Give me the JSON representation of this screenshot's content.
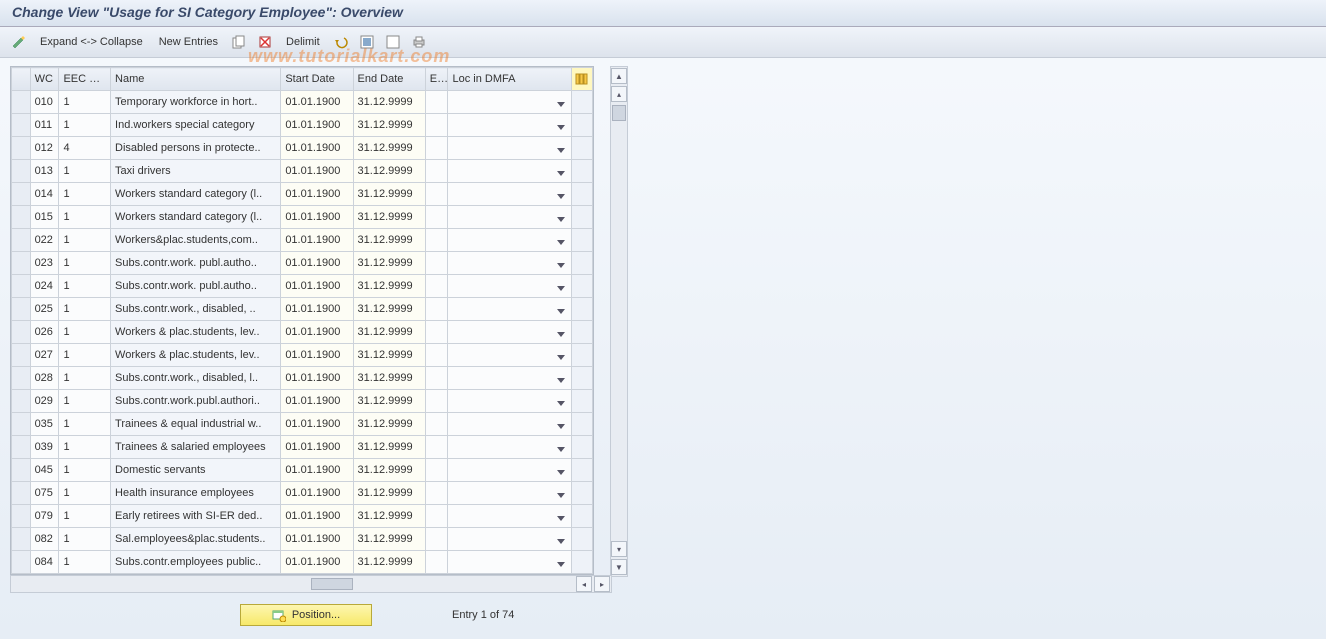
{
  "title": "Change View \"Usage for SI Category Employee\": Overview",
  "watermark": "www.tutorialkart.com",
  "toolbar": {
    "expand_collapse": "Expand <-> Collapse",
    "new_entries": "New Entries",
    "delimit": "Delimit"
  },
  "columns": {
    "wc": "WC",
    "eec": "EEC use",
    "name": "Name",
    "start": "Start Date",
    "end": "End Date",
    "e": "E...",
    "loc": "Loc in DMFA"
  },
  "rows": [
    {
      "wc": "010",
      "eec": "1",
      "name": "Temporary workforce in hort..",
      "start": "01.01.1900",
      "end": "31.12.9999",
      "e": "",
      "loc": ""
    },
    {
      "wc": "011",
      "eec": "1",
      "name": "Ind.workers special category",
      "start": "01.01.1900",
      "end": "31.12.9999",
      "e": "",
      "loc": ""
    },
    {
      "wc": "012",
      "eec": "4",
      "name": "Disabled persons in protecte..",
      "start": "01.01.1900",
      "end": "31.12.9999",
      "e": "",
      "loc": ""
    },
    {
      "wc": "013",
      "eec": "1",
      "name": "Taxi drivers",
      "start": "01.01.1900",
      "end": "31.12.9999",
      "e": "",
      "loc": ""
    },
    {
      "wc": "014",
      "eec": "1",
      "name": "Workers standard category (l..",
      "start": "01.01.1900",
      "end": "31.12.9999",
      "e": "",
      "loc": ""
    },
    {
      "wc": "015",
      "eec": "1",
      "name": "Workers standard category (l..",
      "start": "01.01.1900",
      "end": "31.12.9999",
      "e": "",
      "loc": ""
    },
    {
      "wc": "022",
      "eec": "1",
      "name": "Workers&plac.students,com..",
      "start": "01.01.1900",
      "end": "31.12.9999",
      "e": "",
      "loc": ""
    },
    {
      "wc": "023",
      "eec": "1",
      "name": "Subs.contr.work. publ.autho..",
      "start": "01.01.1900",
      "end": "31.12.9999",
      "e": "",
      "loc": ""
    },
    {
      "wc": "024",
      "eec": "1",
      "name": "Subs.contr.work. publ.autho..",
      "start": "01.01.1900",
      "end": "31.12.9999",
      "e": "",
      "loc": ""
    },
    {
      "wc": "025",
      "eec": "1",
      "name": "Subs.contr.work., disabled, ..",
      "start": "01.01.1900",
      "end": "31.12.9999",
      "e": "",
      "loc": ""
    },
    {
      "wc": "026",
      "eec": "1",
      "name": "Workers & plac.students, lev..",
      "start": "01.01.1900",
      "end": "31.12.9999",
      "e": "",
      "loc": ""
    },
    {
      "wc": "027",
      "eec": "1",
      "name": "Workers & plac.students, lev..",
      "start": "01.01.1900",
      "end": "31.12.9999",
      "e": "",
      "loc": ""
    },
    {
      "wc": "028",
      "eec": "1",
      "name": "Subs.contr.work., disabled, l..",
      "start": "01.01.1900",
      "end": "31.12.9999",
      "e": "",
      "loc": ""
    },
    {
      "wc": "029",
      "eec": "1",
      "name": "Subs.contr.work.publ.authori..",
      "start": "01.01.1900",
      "end": "31.12.9999",
      "e": "",
      "loc": ""
    },
    {
      "wc": "035",
      "eec": "1",
      "name": "Trainees & equal industrial w..",
      "start": "01.01.1900",
      "end": "31.12.9999",
      "e": "",
      "loc": ""
    },
    {
      "wc": "039",
      "eec": "1",
      "name": "Trainees & salaried employees",
      "start": "01.01.1900",
      "end": "31.12.9999",
      "e": "",
      "loc": ""
    },
    {
      "wc": "045",
      "eec": "1",
      "name": "Domestic servants",
      "start": "01.01.1900",
      "end": "31.12.9999",
      "e": "",
      "loc": ""
    },
    {
      "wc": "075",
      "eec": "1",
      "name": "Health insurance employees",
      "start": "01.01.1900",
      "end": "31.12.9999",
      "e": "",
      "loc": ""
    },
    {
      "wc": "079",
      "eec": "1",
      "name": "Early retirees with SI-ER ded..",
      "start": "01.01.1900",
      "end": "31.12.9999",
      "e": "",
      "loc": ""
    },
    {
      "wc": "082",
      "eec": "1",
      "name": "Sal.employees&plac.students..",
      "start": "01.01.1900",
      "end": "31.12.9999",
      "e": "",
      "loc": ""
    },
    {
      "wc": "084",
      "eec": "1",
      "name": "Subs.contr.employees public..",
      "start": "01.01.1900",
      "end": "31.12.9999",
      "e": "",
      "loc": ""
    }
  ],
  "footer": {
    "position_label": "Position...",
    "entry_label": "Entry 1 of 74"
  }
}
